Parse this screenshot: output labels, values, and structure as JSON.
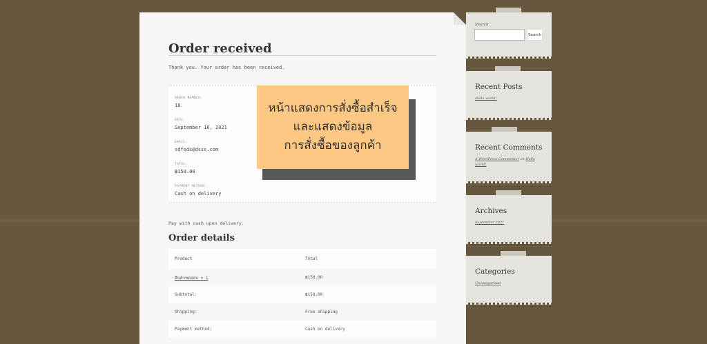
{
  "order": {
    "title": "Order received",
    "thank_you": "Thank you. Your order has been received.",
    "overview": [
      {
        "label": "ORDER NUMBER:",
        "value": "18"
      },
      {
        "label": "DATE:",
        "value": "September 16, 2021"
      },
      {
        "label": "EMAIL:",
        "value": "sdfsds@dsss.com"
      },
      {
        "label": "TOTAL:",
        "value": "฿150.00"
      },
      {
        "label": "PAYMENT METHOD:",
        "value": "Cash on delivery"
      }
    ],
    "pay_note": "Pay with cash upon delivery."
  },
  "callout": {
    "line1": "หน้าแสดงการสั่งซื้อสำเร็จ",
    "line2": "และแสดงข้อมูล",
    "line3": "การสั่งซื้อของลูกค้า"
  },
  "details": {
    "title": "Order details",
    "columns": [
      "Product",
      "Total"
    ],
    "rows": [
      {
        "label": "สินค้าทดสอบ × 1",
        "value": "฿150.00"
      },
      {
        "label": "Subtotal:",
        "value": "฿150.00"
      },
      {
        "label": "Shipping:",
        "value": "Free shipping"
      },
      {
        "label": "Payment method:",
        "value": "Cash on delivery"
      }
    ]
  },
  "sidebar": {
    "search_label": "Search",
    "search_button": "Search",
    "search_placeholder": "",
    "recent_posts_title": "Recent Posts",
    "recent_post": "Hello world!",
    "recent_comments_title": "Recent Comments",
    "comment_author": "A WordPress Commenter",
    "comment_on": "on",
    "comment_post": "Hello world!",
    "archives_title": "Archives",
    "archive_item": "September 2021",
    "categories_title": "Categories",
    "category_item": "Uncategorized"
  },
  "colors": {
    "background": "#66573f",
    "callout": "#fdc883",
    "callout_shadow": "#595959"
  }
}
